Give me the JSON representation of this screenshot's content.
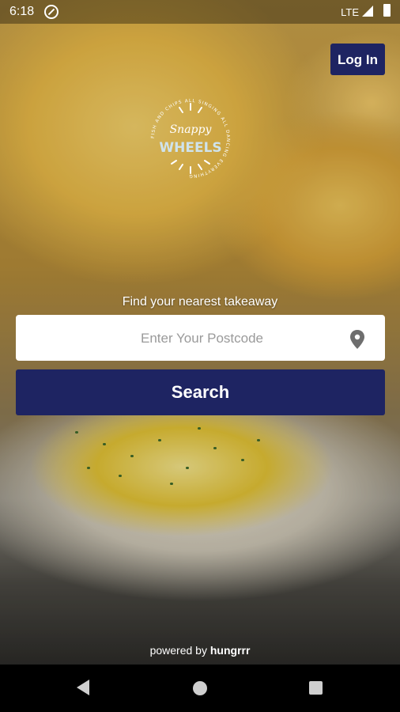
{
  "status_bar": {
    "time": "6:18",
    "network": "LTE"
  },
  "header": {
    "login_label": "Log In"
  },
  "logo": {
    "line1": "Snappy",
    "line2": "WHEELS",
    "ring_text": "FISH AND CHIPS ALL SINGING ALL DANCING EVERYTHING"
  },
  "search": {
    "tagline": "Find your nearest takeaway",
    "placeholder": "Enter Your Postcode",
    "value": "",
    "button_label": "Search"
  },
  "footer": {
    "powered_prefix": "powered by",
    "powered_brand": "hungrrr"
  },
  "colors": {
    "primary": "#1e2462",
    "logo_text": "#ffffff"
  },
  "icons": {
    "location": "map-pin-icon",
    "back": "back-triangle-icon",
    "home": "home-circle-icon",
    "recents": "recents-square-icon"
  }
}
